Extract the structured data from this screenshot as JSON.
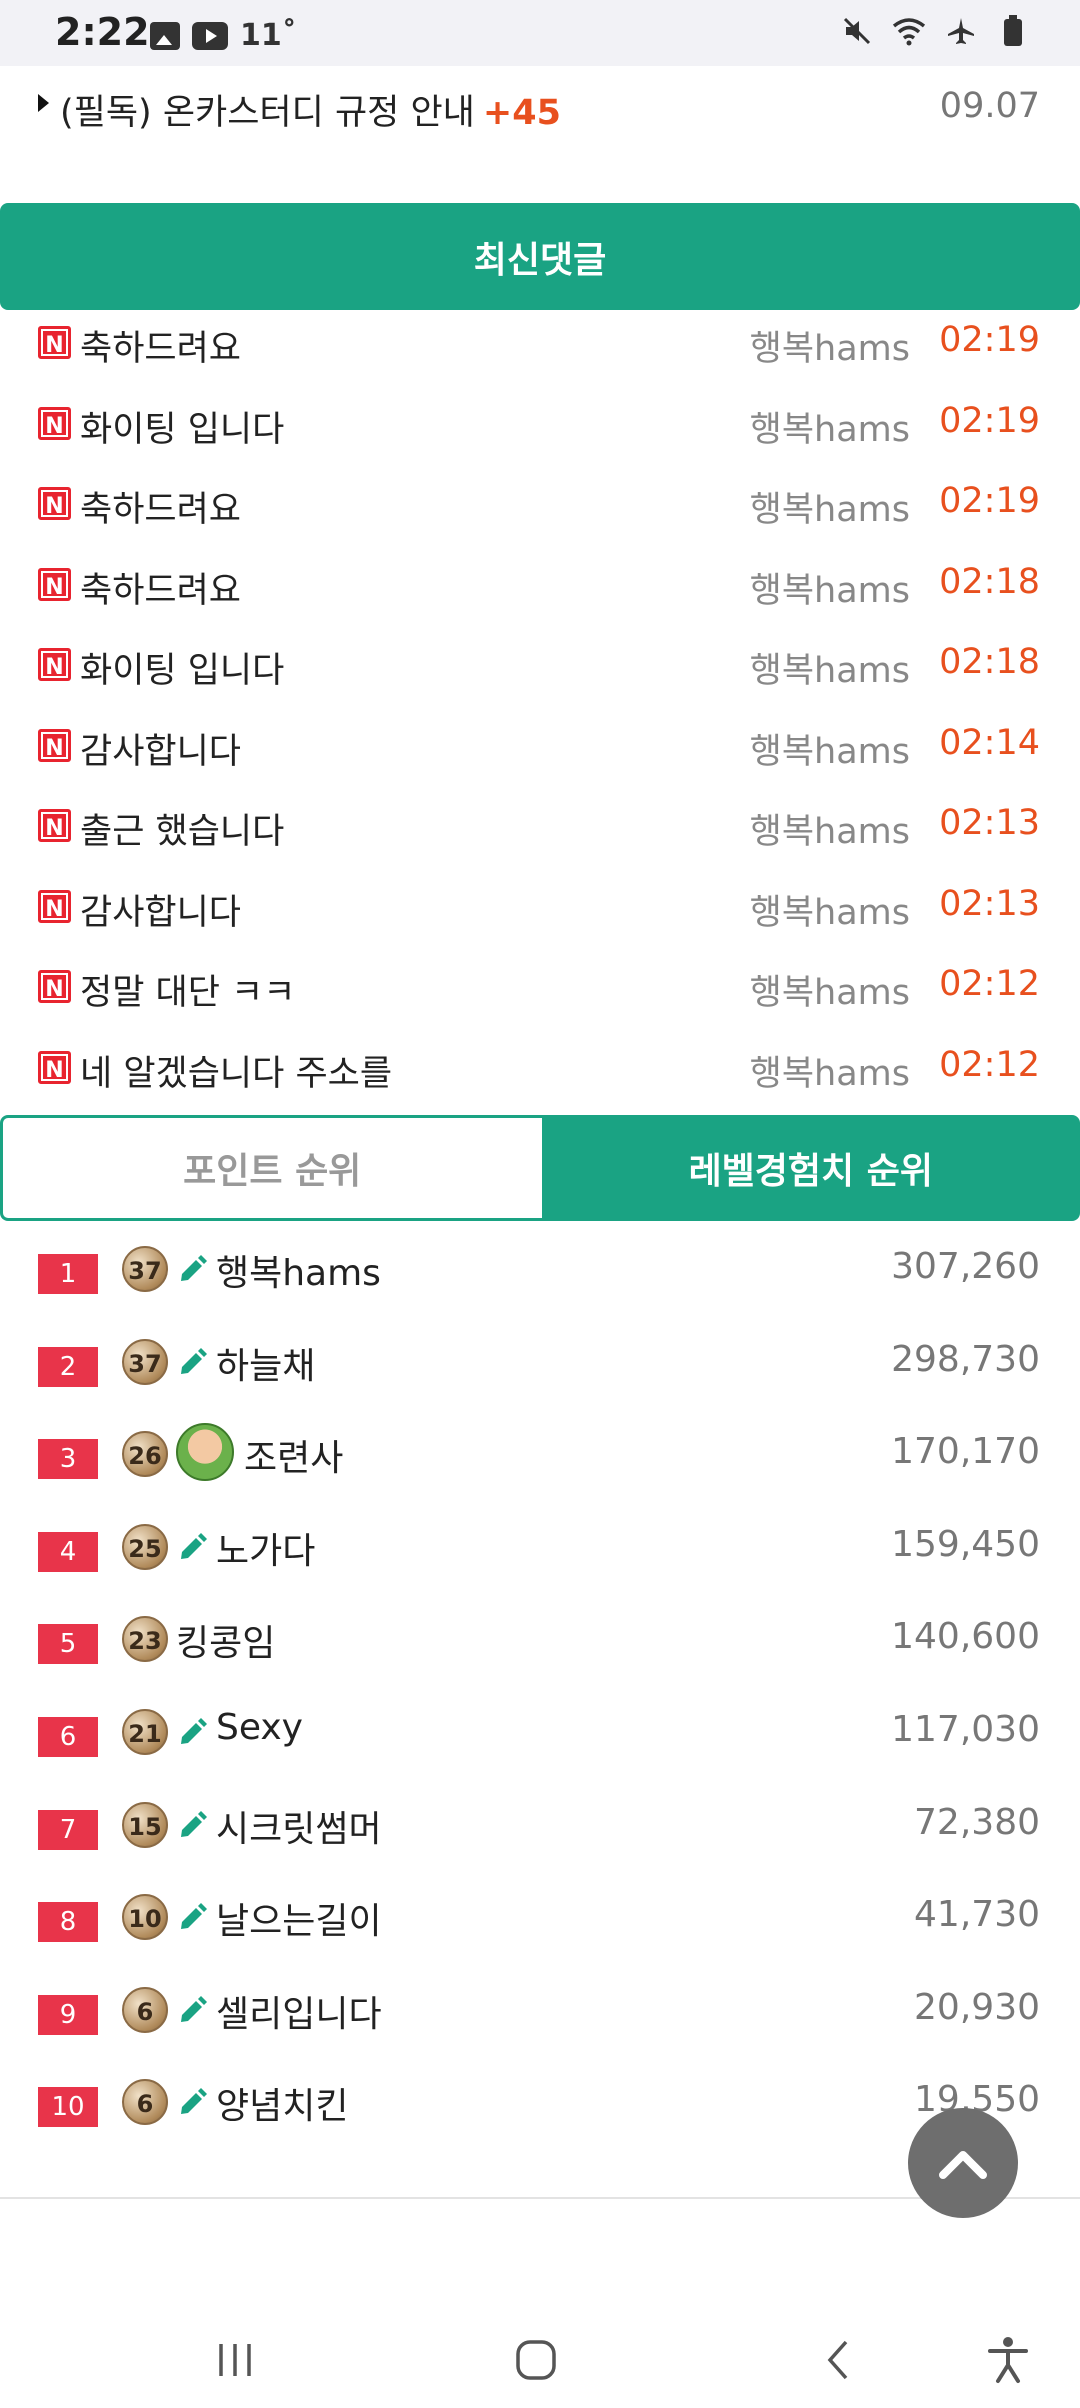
{
  "status_bar": {
    "time": "2:22",
    "temperature": "11˚",
    "icons": [
      "gallery-icon",
      "youtube-icon",
      "mute-icon",
      "wifi-icon",
      "airplane-icon",
      "battery-icon"
    ]
  },
  "notice": {
    "title": "(필독) 온카스터디 규정 안내",
    "count": "+45",
    "date": "09.07"
  },
  "latest_comments": {
    "header": "최신댓글",
    "badge": "N",
    "items": [
      {
        "text": "축하드려요",
        "author": "행복hams",
        "time": "02:19"
      },
      {
        "text": "화이팅 입니다",
        "author": "행복hams",
        "time": "02:19"
      },
      {
        "text": "축하드려요",
        "author": "행복hams",
        "time": "02:19"
      },
      {
        "text": "축하드려요",
        "author": "행복hams",
        "time": "02:18"
      },
      {
        "text": "화이팅 입니다",
        "author": "행복hams",
        "time": "02:18"
      },
      {
        "text": "감사합니다",
        "author": "행복hams",
        "time": "02:14"
      },
      {
        "text": "출근 했습니다",
        "author": "행복hams",
        "time": "02:13"
      },
      {
        "text": "감사합니다",
        "author": "행복hams",
        "time": "02:13"
      },
      {
        "text": "정말 대단 ㅋㅋ",
        "author": "행복hams",
        "time": "02:12"
      },
      {
        "text": "네 알겠습니다 주소를",
        "author": "행복hams",
        "time": "02:12"
      }
    ]
  },
  "tabs": {
    "points": "포인트 순위",
    "level": "레벨경험치 순위"
  },
  "ranking": [
    {
      "rank": "1",
      "level": "37",
      "icon": "pencil",
      "name": "행복hams",
      "score": "307,260"
    },
    {
      "rank": "2",
      "level": "37",
      "icon": "pencil",
      "name": "하늘채",
      "score": "298,730"
    },
    {
      "rank": "3",
      "level": "26",
      "icon": "avatar",
      "name": "조련사",
      "score": "170,170"
    },
    {
      "rank": "4",
      "level": "25",
      "icon": "pencil",
      "name": "노가다",
      "score": "159,450"
    },
    {
      "rank": "5",
      "level": "23",
      "icon": "none",
      "name": "킹콩임",
      "score": "140,600"
    },
    {
      "rank": "6",
      "level": "21",
      "icon": "pencil",
      "name": "Sexy",
      "score": "117,030"
    },
    {
      "rank": "7",
      "level": "15",
      "icon": "pencil",
      "name": "시크릿썸머",
      "score": "72,380"
    },
    {
      "rank": "8",
      "level": "10",
      "icon": "pencil",
      "name": "날으는길이",
      "score": "41,730"
    },
    {
      "rank": "9",
      "level": "6",
      "icon": "pencil",
      "name": "셀리입니다",
      "score": "20,930"
    },
    {
      "rank": "10",
      "level": "6",
      "icon": "pencil",
      "name": "양념치킨",
      "score": "19,550"
    }
  ],
  "colors": {
    "accent": "#1aa383",
    "time": "#e8501e",
    "rank": "#e8344a",
    "new_badge": "#e8242f"
  }
}
